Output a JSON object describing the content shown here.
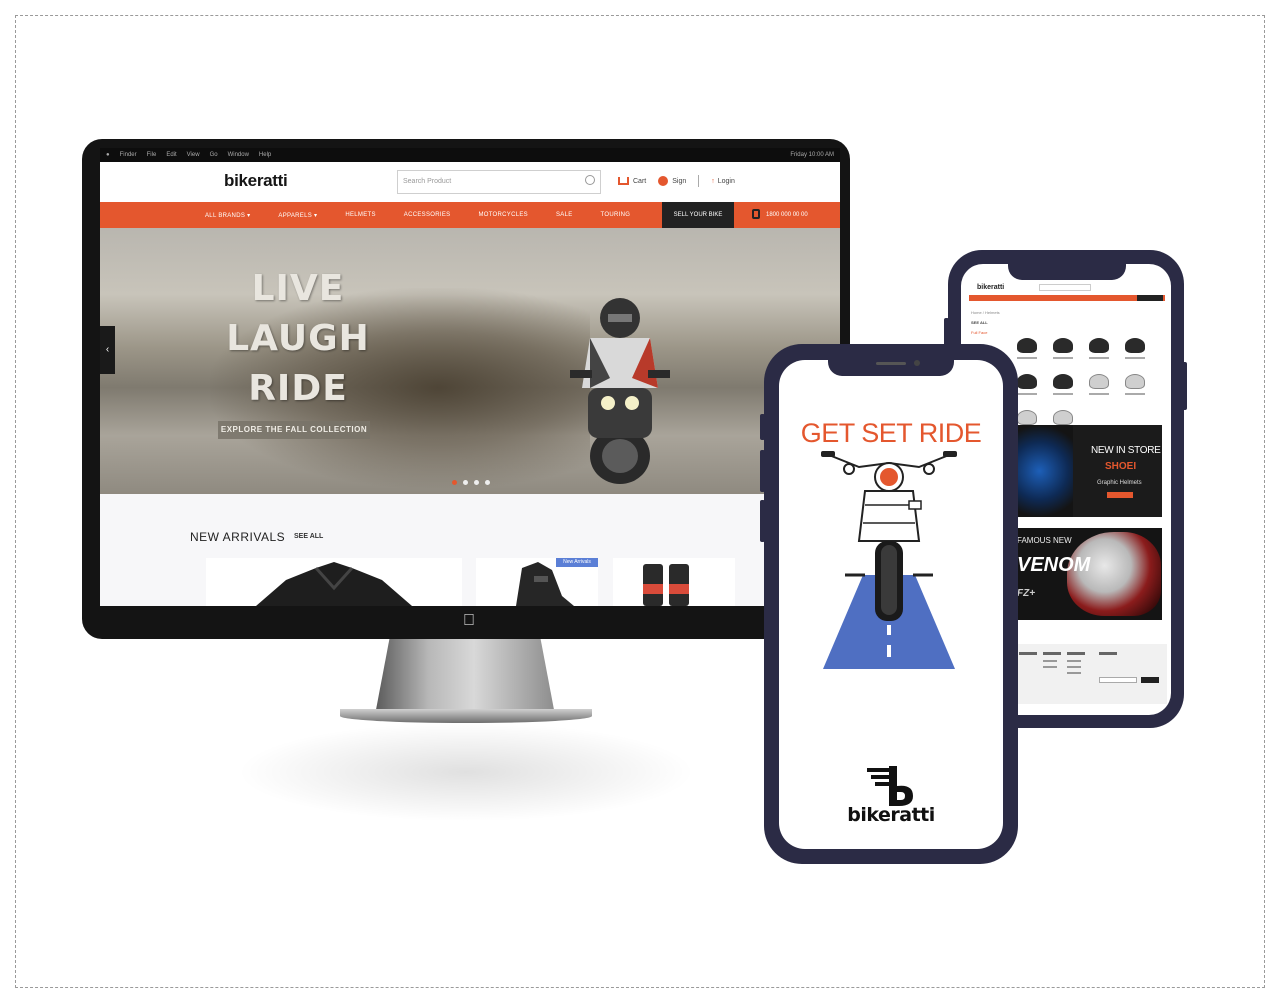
{
  "colors": {
    "brand_orange": "#e4572e",
    "phone_frame": "#2b2b45",
    "nav_dark": "#222222",
    "road_blue": "#4f6fc2"
  },
  "desktop": {
    "mac_menu": [
      "Finder",
      "File",
      "Edit",
      "View",
      "Go",
      "Window",
      "Help"
    ],
    "mac_clock": "Friday 10:00 AM",
    "logo": "bikeratti",
    "search_placeholder": "Search Product",
    "header_links": {
      "cart": "Cart",
      "user": "Sign",
      "account": "Login"
    },
    "nav_items": [
      "ALL BRANDS ▾",
      "APPARELS ▾",
      "HELMETS",
      "ACCESSORIES",
      "MOTORCYCLES",
      "SALE",
      "TOURING"
    ],
    "sell_label": "SELL YOUR BIKE",
    "phone_label": "1800 000 00 00",
    "hero": {
      "line1": "LIVE",
      "line2": "LAUGH",
      "line3": "RIDE",
      "cta": "EXPLORE THE FALL COLLECTION",
      "slides": 4,
      "active_slide": 1
    },
    "arrivals": {
      "title": "NEW ARRIVALS",
      "see_all": "SEE ALL",
      "badge": "New Arrivals"
    }
  },
  "back_phone": {
    "logo": "bikeratti",
    "breadcrumb": "Home / Helmets",
    "section": "SEE ALL",
    "subsection": "Full Face",
    "banner1": {
      "line1": "NEW IN STORE",
      "line2": "SHOEI",
      "line3": "Graphic Helmets"
    },
    "banner2": {
      "line1": "FAMOUS NEW",
      "line2": "VENOM",
      "line3": "FZ+"
    }
  },
  "front_phone": {
    "heading": "GET SET RIDE",
    "logo_text": "bikeratti"
  }
}
